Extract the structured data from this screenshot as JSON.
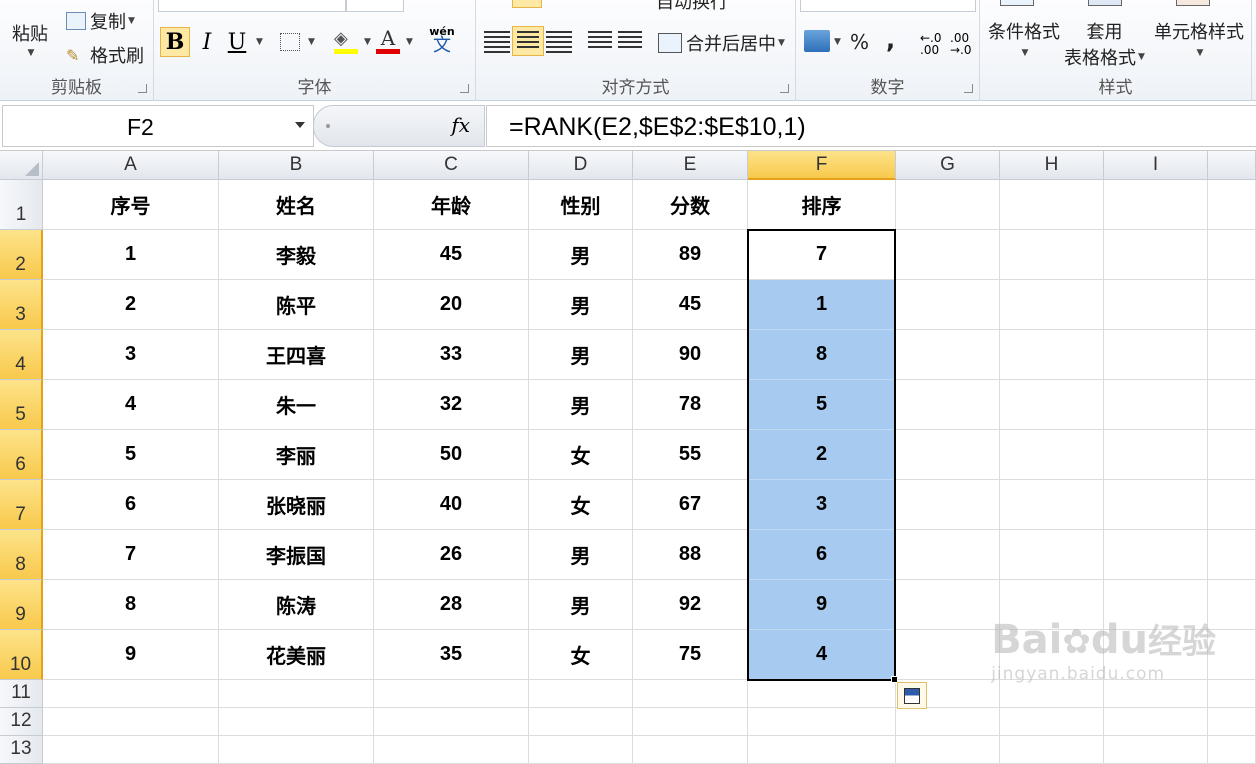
{
  "ribbon": {
    "clipboard": {
      "label": "剪贴板",
      "paste": "粘贴",
      "copy": "复制",
      "format_painter": "格式刷"
    },
    "font": {
      "label": "字体",
      "bold": "B",
      "italic": "I",
      "underline": "U",
      "wen": "wén",
      "wen_char": "文"
    },
    "alignment": {
      "label": "对齐方式",
      "wrap": "自动换行",
      "merge": "合并后居中"
    },
    "number": {
      "label": "数字",
      "percent": "%",
      "comma": ","
    },
    "styles": {
      "label": "样式",
      "conditional": "条件格式",
      "table_line1": "套用",
      "table_line2": "表格格式",
      "cell_styles": "单元格样式"
    }
  },
  "formula_bar": {
    "name_box": "F2",
    "fx": "fx",
    "formula": "=RANK(E2,$E$2:$E$10,1)"
  },
  "sheet": {
    "columns": [
      "A",
      "B",
      "C",
      "D",
      "E",
      "F",
      "G",
      "H",
      "I"
    ],
    "rows": [
      "1",
      "2",
      "3",
      "4",
      "5",
      "6",
      "7",
      "8",
      "9",
      "10",
      "11",
      "12",
      "13"
    ],
    "headers": [
      "序号",
      "姓名",
      "年龄",
      "性别",
      "分数",
      "排序"
    ],
    "data": [
      [
        "1",
        "李毅",
        "45",
        "男",
        "89",
        "7"
      ],
      [
        "2",
        "陈平",
        "20",
        "男",
        "45",
        "1"
      ],
      [
        "3",
        "王四喜",
        "33",
        "男",
        "90",
        "8"
      ],
      [
        "4",
        "朱一",
        "32",
        "男",
        "78",
        "5"
      ],
      [
        "5",
        "李丽",
        "50",
        "女",
        "55",
        "2"
      ],
      [
        "6",
        "张晓丽",
        "40",
        "女",
        "67",
        "3"
      ],
      [
        "7",
        "李振国",
        "26",
        "男",
        "88",
        "6"
      ],
      [
        "8",
        "陈涛",
        "28",
        "男",
        "92",
        "9"
      ],
      [
        "9",
        "花美丽",
        "35",
        "女",
        "75",
        "4"
      ]
    ],
    "selected_column": "F",
    "selected_cell": "F2"
  },
  "watermark": {
    "brand": "Bai",
    "brand2": "du",
    "cn": "经验",
    "url": "jingyan.baidu.com"
  },
  "colors": {
    "selection_fill": "#a6caf0",
    "header_selected": "#f8c94c"
  }
}
